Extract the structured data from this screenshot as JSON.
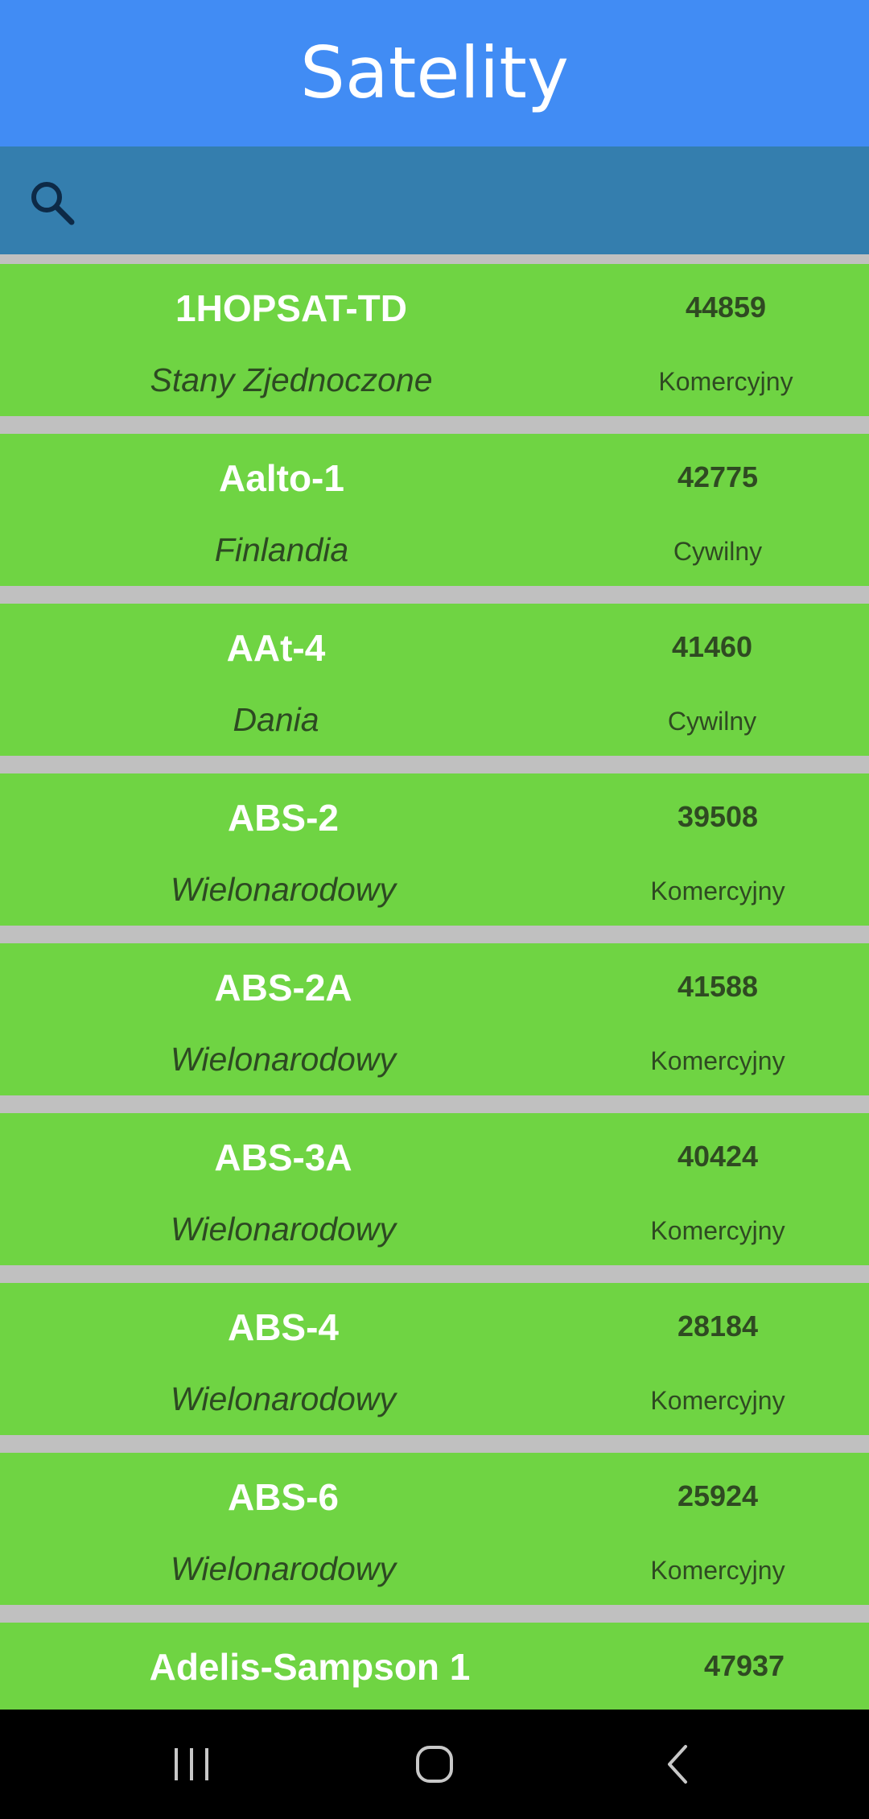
{
  "app": {
    "title": "Satelity"
  },
  "search": {
    "icon": "search-icon",
    "value": "",
    "placeholder": ""
  },
  "satellites": [
    {
      "name": "1HOPSAT-TD",
      "norad": "44859",
      "country": "Stany Zjednoczone",
      "category": "Komercyjny"
    },
    {
      "name": "Aalto-1",
      "norad": "42775",
      "country": "Finlandia",
      "category": "Cywilny"
    },
    {
      "name": "AAt-4",
      "norad": "41460",
      "country": "Dania",
      "category": "Cywilny"
    },
    {
      "name": "ABS-2",
      "norad": "39508",
      "country": "Wielonarodowy",
      "category": "Komercyjny"
    },
    {
      "name": "ABS-2A",
      "norad": "41588",
      "country": "Wielonarodowy",
      "category": "Komercyjny"
    },
    {
      "name": "ABS-3A",
      "norad": "40424",
      "country": "Wielonarodowy",
      "category": "Komercyjny"
    },
    {
      "name": "ABS-4",
      "norad": "28184",
      "country": "Wielonarodowy",
      "category": "Komercyjny"
    },
    {
      "name": "ABS-6",
      "norad": "25924",
      "country": "Wielonarodowy",
      "category": "Komercyjny"
    },
    {
      "name": "Adelis-Sampson 1",
      "norad": "47937",
      "country": "",
      "category": ""
    }
  ],
  "navigation": {
    "recents_icon": "recents-icon",
    "home_icon": "home-icon",
    "back_icon": "back-icon"
  },
  "colors": {
    "title_bar": "#418cf4",
    "search_bar": "#347eae",
    "card": "#6fd443",
    "separator": "#c0c0c0",
    "nav_bar": "#000000"
  }
}
